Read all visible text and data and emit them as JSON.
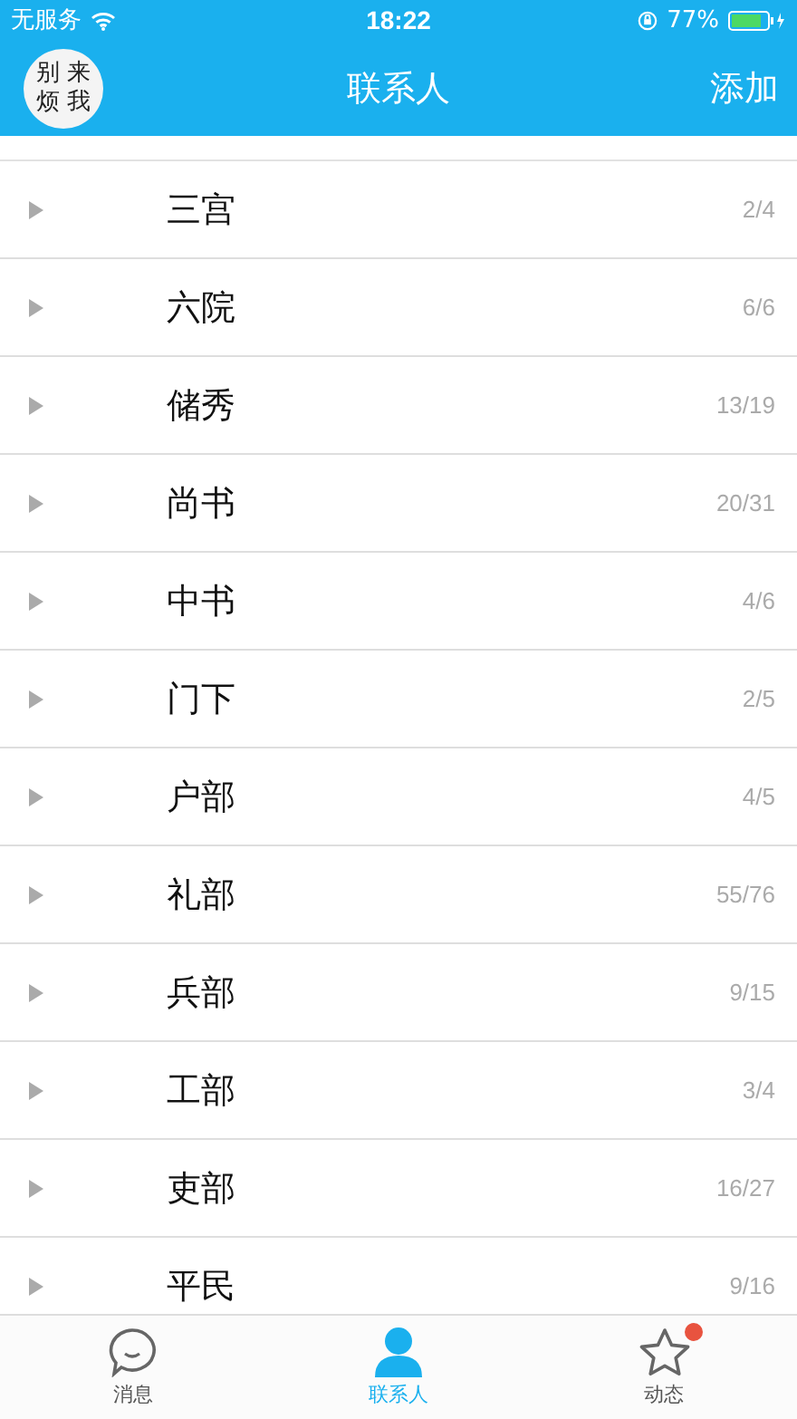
{
  "status_bar": {
    "carrier": "无服务",
    "time": "18:22",
    "battery_percent": "77%"
  },
  "header": {
    "avatar_text": [
      "别",
      "来",
      "烦",
      "我"
    ],
    "title": "联系人",
    "action": "添加"
  },
  "groups": [
    {
      "name": "三宫",
      "count": "2/4",
      "expanded": false
    },
    {
      "name": "六院",
      "count": "6/6",
      "expanded": false
    },
    {
      "name": "储秀",
      "count": "13/19",
      "expanded": false
    },
    {
      "name": "尚书",
      "count": "20/31",
      "expanded": false
    },
    {
      "name": "中书",
      "count": "4/6",
      "expanded": false
    },
    {
      "name": "门下",
      "count": "2/5",
      "expanded": false
    },
    {
      "name": "户部",
      "count": "4/5",
      "expanded": false
    },
    {
      "name": "礼部",
      "count": "55/76",
      "expanded": false
    },
    {
      "name": "兵部",
      "count": "9/15",
      "expanded": false
    },
    {
      "name": "工部",
      "count": "3/4",
      "expanded": false
    },
    {
      "name": "吏部",
      "count": "16/27",
      "expanded": false
    },
    {
      "name": "平民",
      "count": "9/16",
      "expanded": false
    }
  ],
  "tabs": [
    {
      "label": "消息",
      "kind": "chat",
      "selected": false,
      "badge": false
    },
    {
      "label": "联系人",
      "kind": "person",
      "selected": true,
      "badge": false
    },
    {
      "label": "动态",
      "kind": "star",
      "selected": false,
      "badge": true
    }
  ]
}
